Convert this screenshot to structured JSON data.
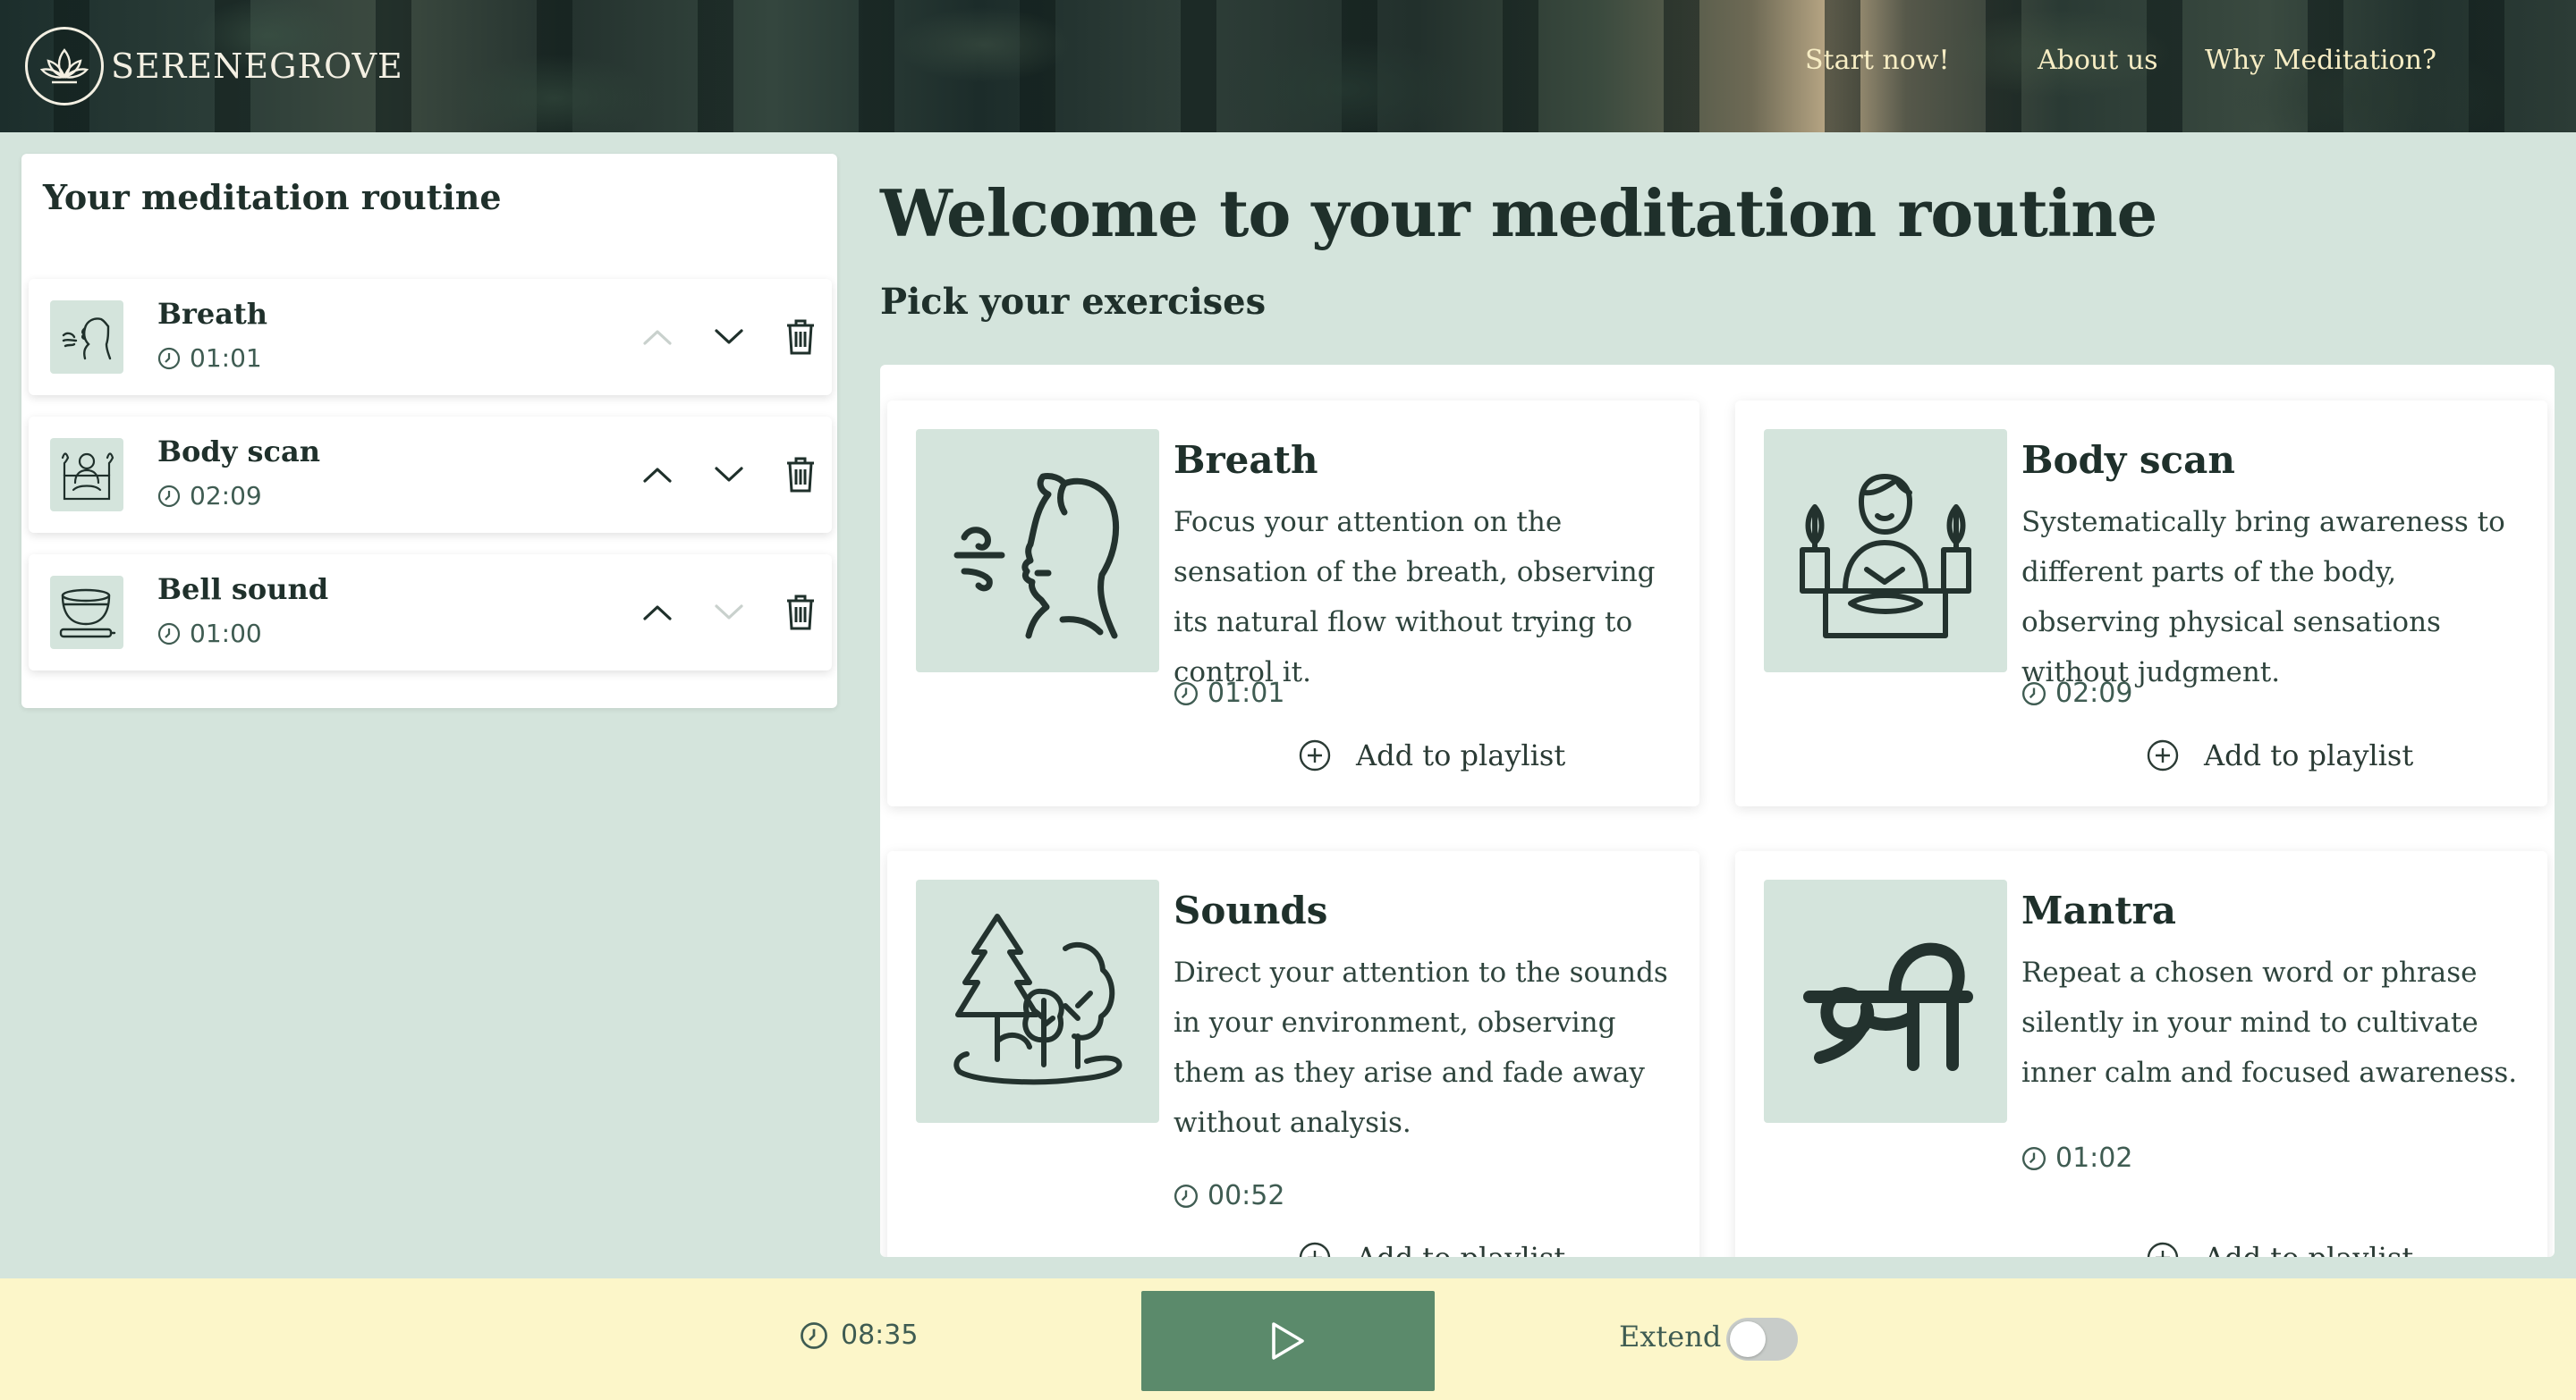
{
  "brand": {
    "name": "SERENEGROVE",
    "logo_icon": "lotus-icon"
  },
  "nav": {
    "items": [
      {
        "label": "Start now!"
      },
      {
        "label": "About us"
      },
      {
        "label": "Why Meditation?"
      }
    ]
  },
  "routine": {
    "title": "Your meditation routine",
    "items": [
      {
        "title": "Breath",
        "time": "01:01",
        "icon": "breath-icon",
        "up_enabled": false,
        "down_enabled": true
      },
      {
        "title": "Body scan",
        "time": "02:09",
        "icon": "body-scan-icon",
        "up_enabled": true,
        "down_enabled": true
      },
      {
        "title": "Bell sound",
        "time": "01:00",
        "icon": "singing-bowl-icon",
        "up_enabled": true,
        "down_enabled": false
      }
    ]
  },
  "main": {
    "heading": "Welcome to your meditation routine",
    "subheading": "Pick your exercises",
    "exercises": [
      {
        "title": "Breath",
        "description": "Focus your attention on the sensation of the breath, observing its natural flow without trying to control it.",
        "time": "01:01",
        "add_label": "Add to playlist",
        "icon": "breath-icon"
      },
      {
        "title": "Body scan",
        "description": "Systematically bring awareness to different parts of the body, observing physical sensations without judgment.",
        "time": "02:09",
        "add_label": "Add to playlist",
        "icon": "body-scan-icon"
      },
      {
        "title": "Sounds",
        "description": "Direct your attention to the sounds in your environment, observing them as they arise and fade away without analysis.",
        "time": "00:52",
        "add_label": "Add to playlist",
        "icon": "nature-sounds-icon"
      },
      {
        "title": "Mantra",
        "description": "Repeat a chosen word or phrase silently in your mind to cultivate inner calm and focused awareness.",
        "time": "01:02",
        "add_label": "Add to playlist",
        "icon": "mantra-icon"
      }
    ]
  },
  "footer": {
    "total_time": "08:35",
    "extend_label": "Extend",
    "extend_on": false
  },
  "colors": {
    "background": "#d4e4dc",
    "accent": "#5b8a6b",
    "footer": "#fcf6c9",
    "text": "#1f302b"
  }
}
